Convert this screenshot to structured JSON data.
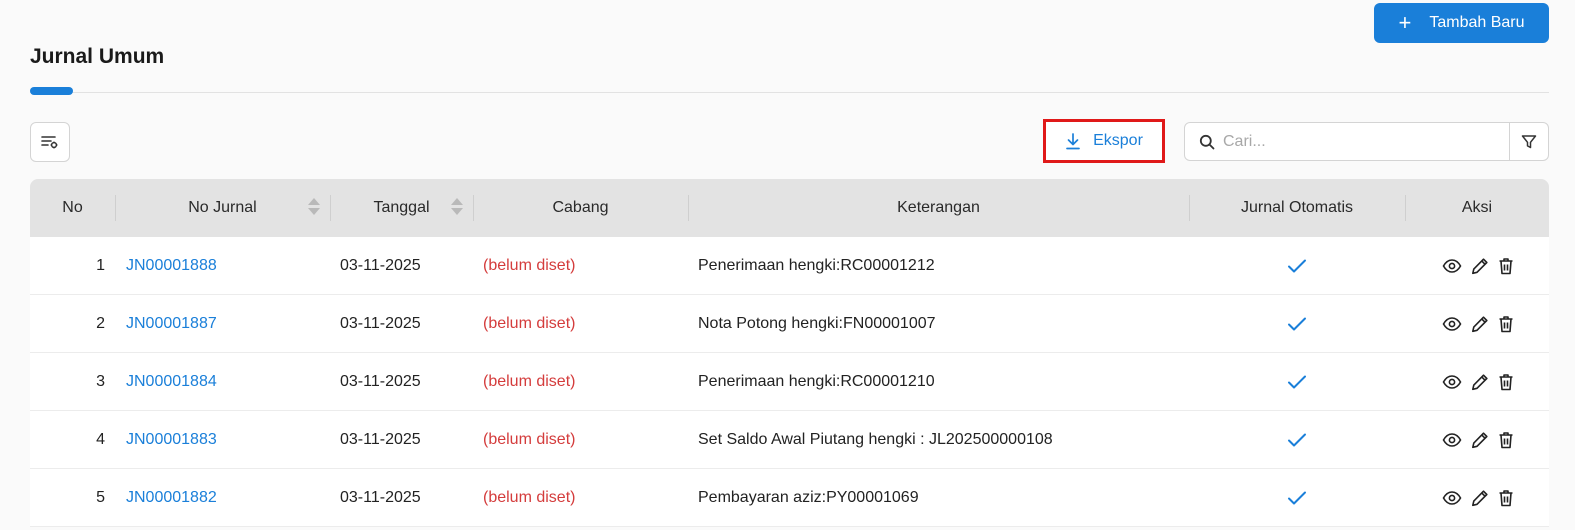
{
  "header": {
    "title": "Jurnal Umum",
    "add_button_label": "Tambah Baru"
  },
  "toolbar": {
    "export_label": "Ekspor",
    "search_placeholder": "Cari..."
  },
  "table": {
    "columns": [
      "No",
      "No Jurnal",
      "Tanggal",
      "Cabang",
      "Keterangan",
      "Jurnal Otomatis",
      "Aksi"
    ],
    "rows": [
      {
        "no": "1",
        "jurnal": "JN00001888",
        "tanggal": "03-11-2025",
        "cabang": "(belum diset)",
        "keterangan": "Penerimaan hengki:RC00001212",
        "otomatis": true
      },
      {
        "no": "2",
        "jurnal": "JN00001887",
        "tanggal": "03-11-2025",
        "cabang": "(belum diset)",
        "keterangan": "Nota Potong hengki:FN00001007",
        "otomatis": true
      },
      {
        "no": "3",
        "jurnal": "JN00001884",
        "tanggal": "03-11-2025",
        "cabang": "(belum diset)",
        "keterangan": "Penerimaan hengki:RC00001210",
        "otomatis": true
      },
      {
        "no": "4",
        "jurnal": "JN00001883",
        "tanggal": "03-11-2025",
        "cabang": "(belum diset)",
        "keterangan": "Set Saldo Awal Piutang hengki : JL202500000108",
        "otomatis": true
      },
      {
        "no": "5",
        "jurnal": "JN00001882",
        "tanggal": "03-11-2025",
        "cabang": "(belum diset)",
        "keterangan": "Pembayaran aziz:PY00001069",
        "otomatis": true
      }
    ]
  },
  "icons": {
    "add": "plus-icon",
    "settings": "column-settings-icon",
    "export": "download-icon",
    "search": "search-icon",
    "filter": "filter-icon",
    "auto": "check-icon",
    "view": "eye-icon",
    "edit": "pencil-icon",
    "delete": "trash-icon"
  },
  "colors": {
    "primary": "#1a7fd9",
    "highlight": "#e01919",
    "unset": "#d43c3c",
    "header_bg": "#e3e3e3"
  }
}
